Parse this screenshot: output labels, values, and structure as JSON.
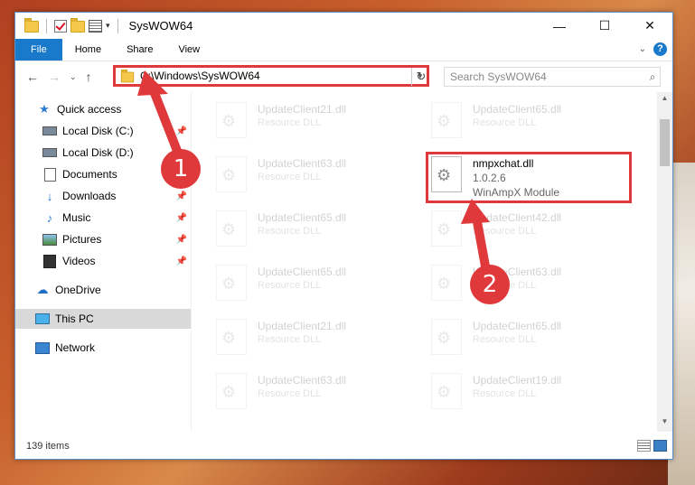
{
  "window": {
    "title": "SysWOW64",
    "controls": {
      "minimize": "—",
      "maximize": "☐",
      "close": "✕"
    }
  },
  "ribbon": {
    "tabs": [
      "File",
      "Home",
      "Share",
      "View"
    ],
    "help": "?"
  },
  "nav_buttons": {
    "back": "←",
    "forward": "→",
    "recent": "⌄",
    "up": "↑"
  },
  "address": {
    "path": "C:\\Windows\\SysWOW64",
    "refresh": "↻"
  },
  "search": {
    "placeholder": "Search SysWOW64",
    "icon": "search-icon"
  },
  "sidebar": {
    "items": [
      {
        "label": "Quick access",
        "icon": "star-icon",
        "pinned": false
      },
      {
        "label": "Local Disk (C:)",
        "icon": "disk-icon",
        "pinned": true
      },
      {
        "label": "Local Disk (D:)",
        "icon": "disk-icon",
        "pinned": false
      },
      {
        "label": "Documents",
        "icon": "documents-icon",
        "pinned": false
      },
      {
        "label": "Downloads",
        "icon": "downloads-icon",
        "pinned": true
      },
      {
        "label": "Music",
        "icon": "music-icon",
        "pinned": true
      },
      {
        "label": "Pictures",
        "icon": "pictures-icon",
        "pinned": true
      },
      {
        "label": "Videos",
        "icon": "videos-icon",
        "pinned": true
      },
      {
        "label": "OneDrive",
        "icon": "cloud-icon",
        "pinned": false
      },
      {
        "label": "This PC",
        "icon": "pc-icon",
        "pinned": false,
        "selected": true
      },
      {
        "label": "Network",
        "icon": "network-icon",
        "pinned": false
      }
    ]
  },
  "files": [
    {
      "name": "UpdateClient21.dll",
      "type": "Resource DLL"
    },
    {
      "name": "UpdateClient65.dll",
      "type": "Resource DLL"
    },
    {
      "name": "UpdateClient63.dll",
      "type": "Resource DLL"
    },
    {
      "name": "nmpxchat.dll",
      "version": "1.0.2.6",
      "type": "WinAmpX Module",
      "highlighted": true
    },
    {
      "name": "UpdateClient65.dll",
      "type": "Resource DLL"
    },
    {
      "name": "UpdateClient42.dll",
      "type": "Resource DLL"
    },
    {
      "name": "UpdateClient65.dll",
      "type": "Resource DLL"
    },
    {
      "name": "UpdateClient63.dll",
      "type": "Resource DLL"
    },
    {
      "name": "UpdateClient21.dll",
      "type": "Resource DLL"
    },
    {
      "name": "UpdateClient65.dll",
      "type": "Resource DLL"
    },
    {
      "name": "UpdateClient63.dll",
      "type": "Resource DLL"
    },
    {
      "name": "UpdateClient19.dll",
      "type": "Resource DLL"
    }
  ],
  "status": {
    "item_count": "139 items"
  },
  "annotations": {
    "step1": "1",
    "step2": "2"
  },
  "colors": {
    "accent": "#1979ca",
    "highlight": "#e0393b",
    "selected_bg": "#d9d9d9"
  }
}
